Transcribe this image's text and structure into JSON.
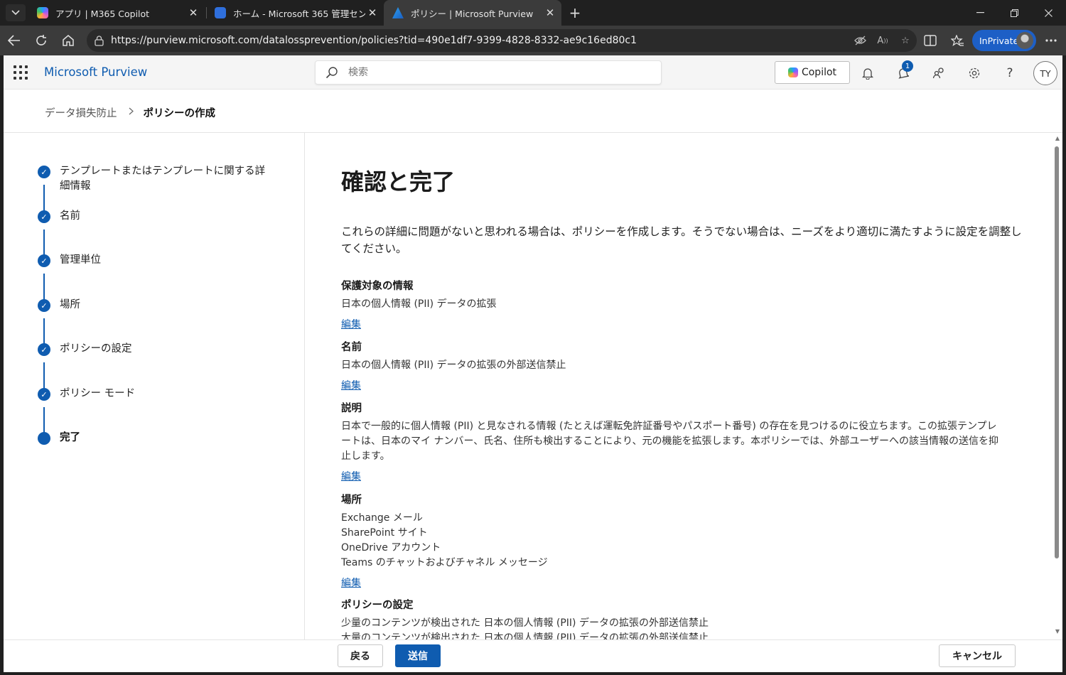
{
  "browser": {
    "tabs": [
      {
        "title": "アプリ | M365 Copilot",
        "active": false,
        "icon_color": "#8c5cff"
      },
      {
        "title": "ホーム - Microsoft 365 管理センター",
        "active": false,
        "icon_color": "#2f6fdc"
      },
      {
        "title": "ポリシー | Microsoft Purview",
        "active": true,
        "icon_color": "#2ea0f0"
      }
    ],
    "url": "https://purview.microsoft.com/datalossprevention/policies?tid=490e1df7-9399-4828-8332-ae9c16ed80c1",
    "inprivate_label": "InPrivate"
  },
  "suite": {
    "brand": "Microsoft Purview",
    "search_placeholder": "検索",
    "copilot_label": "Copilot",
    "notification_count": "1",
    "user_initials": "TY"
  },
  "breadcrumb": {
    "parent": "データ損失防止",
    "current": "ポリシーの作成"
  },
  "steps": [
    {
      "label": "テンプレートまたはテンプレートに関する詳細情報",
      "status": "complete"
    },
    {
      "label": "名前",
      "status": "complete"
    },
    {
      "label": "管理単位",
      "status": "complete"
    },
    {
      "label": "場所",
      "status": "complete"
    },
    {
      "label": "ポリシーの設定",
      "status": "complete"
    },
    {
      "label": "ポリシー モード",
      "status": "complete"
    },
    {
      "label": "完了",
      "status": "current"
    }
  ],
  "main": {
    "title": "確認と完了",
    "intro": "これらの詳細に問題がないと思われる場合は、ポリシーを作成します。そうでない場合は、ニーズをより適切に満たすように設定を調整してください。",
    "edit_label": "編集",
    "sections": [
      {
        "title": "保護対象の情報",
        "values": [
          "日本の個人情報 (PII) データの拡張"
        ]
      },
      {
        "title": "名前",
        "values": [
          "日本の個人情報 (PII) データの拡張の外部送信禁止"
        ]
      },
      {
        "title": "説明",
        "values": [
          "日本で一般的に個人情報 (PII) と見なされる情報 (たとえば運転免許証番号やパスポート番号) の存在を見つけるのに役立ちます。この拡張テンプレートは、日本のマイ ナンバー、氏名、住所も検出することにより、元の機能を拡張します。本ポリシーでは、外部ユーザーへの該当情報の送信を抑止します。"
        ]
      },
      {
        "title": "場所",
        "values": [
          "Exchange メール",
          "SharePoint サイト",
          "OneDrive アカウント",
          "Teams のチャットおよびチャネル メッセージ"
        ]
      },
      {
        "title": "ポリシーの設定",
        "values": [
          "少量のコンテンツが検出された 日本の個人情報 (PII) データの拡張の外部送信禁止",
          "大量のコンテンツが検出された 日本の個人情報 (PII) データの拡張の外部送信禁止"
        ]
      }
    ]
  },
  "footer": {
    "back_label": "戻る",
    "submit_label": "送信",
    "cancel_label": "キャンセル"
  },
  "colors": {
    "accent": "#0f5cb0",
    "browser_chrome": "#202020",
    "inprivate": "#1d5fc6"
  }
}
